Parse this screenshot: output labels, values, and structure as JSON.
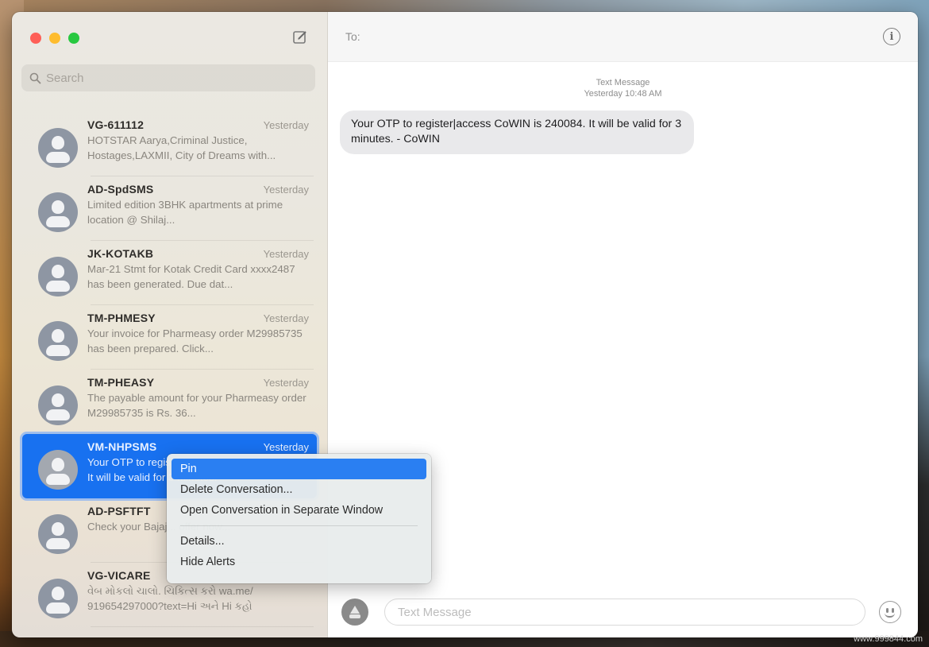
{
  "window": {
    "traffic_lights": [
      "close",
      "minimize",
      "zoom"
    ]
  },
  "sidebar": {
    "compose_icon": "compose-icon",
    "search": {
      "placeholder": "Search",
      "icon": "search-icon"
    },
    "conversations": [
      {
        "name": "VG-611112",
        "time": "Yesterday",
        "preview": "HOTSTAR Aarya,Criminal Justice, Hostages,LAXMII, City of Dreams with...",
        "selected": false
      },
      {
        "name": "AD-SpdSMS",
        "time": "Yesterday",
        "preview": "Limited edition 3BHK apartments at prime location @ Shilaj...",
        "selected": false
      },
      {
        "name": "JK-KOTAKB",
        "time": "Yesterday",
        "preview": "Mar-21 Stmt for Kotak Credit Card xxxx2487 has been generated. Due dat...",
        "selected": false
      },
      {
        "name": "TM-PHMESY",
        "time": "Yesterday",
        "preview": "Your invoice for Pharmeasy order M29985735 has been prepared. Click...",
        "selected": false
      },
      {
        "name": "TM-PHEASY",
        "time": "Yesterday",
        "preview": "The payable amount for your Pharmeasy order M29985735 is Rs. 36...",
        "selected": false
      },
      {
        "name": "VM-NHPSMS",
        "time": "Yesterday",
        "preview": "Your OTP to register|access CoWIN is 240084. It will be valid for 3 minutes.",
        "selected": true
      },
      {
        "name": "AD-PSFTFT",
        "time": "",
        "preview": "Check your Bajaj... offer now...",
        "selected": false
      },
      {
        "name": "VG-VICARE",
        "time": "",
        "preview": "વેબ મોકલો ચાલો. ચિકિત્સ કરો wa.me/ 919654297000?text=Hi અને Hi કહો",
        "selected": false
      }
    ]
  },
  "main": {
    "to_label": "To:",
    "info_icon": "info-icon",
    "message_meta": {
      "service": "Text Message",
      "timestamp": "Yesterday 10:48 AM"
    },
    "messages": [
      {
        "direction": "incoming",
        "text": "Your OTP to register|access CoWIN is 240084. It will be valid for 3 minutes. - CoWIN"
      }
    ],
    "compose": {
      "placeholder": "Text Message",
      "apps_icon": "app-store-icon",
      "emoji_icon": "emoji-icon"
    }
  },
  "context_menu": {
    "items": [
      {
        "label": "Pin",
        "highlighted": true
      },
      {
        "label": "Delete Conversation...",
        "highlighted": false
      },
      {
        "label": "Open Conversation in Separate Window",
        "highlighted": false
      },
      {
        "separator": true
      },
      {
        "label": "Details...",
        "highlighted": false
      },
      {
        "label": "Hide Alerts",
        "highlighted": false
      }
    ]
  },
  "watermark": "www.999844.com",
  "colors": {
    "selection_blue": "#1871f0",
    "menu_highlight": "#2a7ff2",
    "close": "#fe5f57",
    "minimize": "#febc2e",
    "zoom": "#28c840",
    "bubble_gray": "#e9e9eb"
  }
}
